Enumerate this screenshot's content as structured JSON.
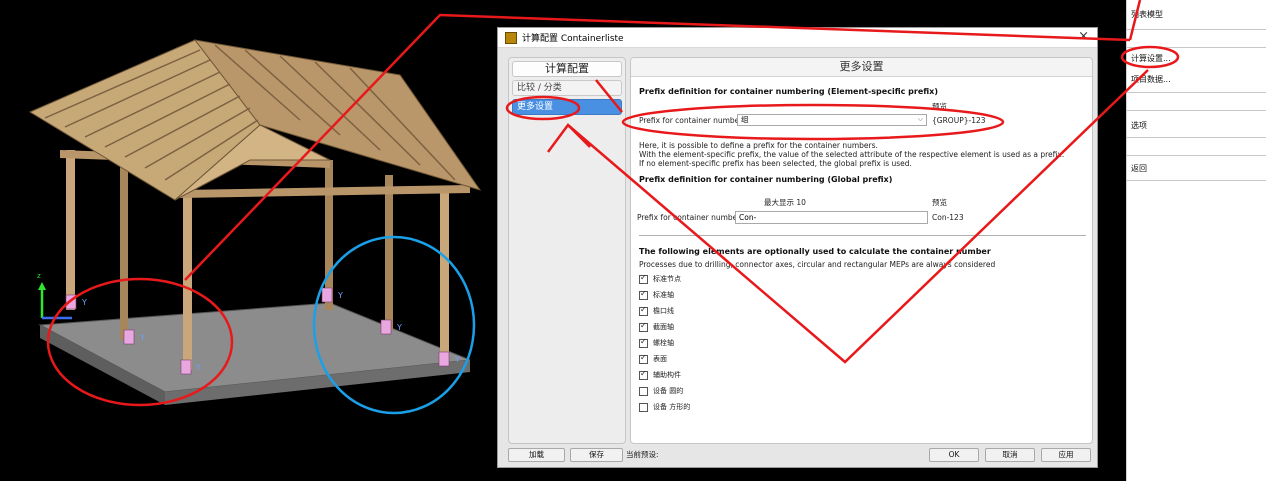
{
  "viewport": {
    "axis_labels": {
      "z": "z",
      "y": "Y"
    },
    "markers": [
      "Y",
      "Y",
      "Y",
      "Y",
      "Y",
      "Y"
    ]
  },
  "dialog": {
    "title": "计算配置 Containerliste",
    "close_glyph": "×",
    "left_panel": {
      "header": "计算配置",
      "items": [
        {
          "label": "比较 / 分类",
          "active": false
        },
        {
          "label": "更多设置",
          "active": true
        }
      ]
    },
    "right_panel": {
      "header": "更多设置",
      "element_prefix": {
        "title": "Prefix definition for container numbering (Element-specific  prefix)",
        "preview_header": "预览",
        "field_label": "Prefix for container number",
        "select_value": "组",
        "preview_value": "{GROUP}-123",
        "help_lines": [
          "Here, it is possible to define a prefix for the container numbers.",
          "With the element-specific prefix, the value of the selected attribute of the respective element is used as a prefix.",
          "If no element-specific prefix has been selected, the global prefix  is used."
        ]
      },
      "global_prefix": {
        "title": "Prefix definition for container numbering (Global prefix)",
        "max_label": "最大显示 10",
        "preview_header": "预览",
        "field_label": "Prefix for container number",
        "input_value": "Con-",
        "preview_value": "Con-123"
      },
      "elements": {
        "title": "The following elements are optionally used to calculate the  container number",
        "note": "Processes due to drilling, connector axes, circular and rectangular MEPs are always considered",
        "checkboxes": [
          {
            "label": "标准节点",
            "checked": true
          },
          {
            "label": "标准轴",
            "checked": true
          },
          {
            "label": "檐口线",
            "checked": true
          },
          {
            "label": "截面轴",
            "checked": true
          },
          {
            "label": "螺栓轴",
            "checked": true
          },
          {
            "label": "表面",
            "checked": true
          },
          {
            "label": "辅助构件",
            "checked": true
          },
          {
            "label": "设备 圆的",
            "checked": false
          },
          {
            "label": "设备 方形的",
            "checked": false
          }
        ]
      }
    },
    "bottom": {
      "load_label": "加载",
      "save_label": "保存",
      "preset_label": "当前预设:",
      "ok_label": "OK",
      "cancel_label": "取消",
      "apply_label": "应用"
    }
  },
  "context_menu": {
    "items": [
      "列表模型",
      "计算设置...",
      "项目数据...",
      "选项",
      "返回"
    ]
  },
  "colors": {
    "annotation_red": "#e8191b",
    "annotation_blue": "#1aa0e8",
    "active_item": "#4a90e2",
    "slab": "#8a8a8a",
    "timber": "#c9a77a"
  }
}
